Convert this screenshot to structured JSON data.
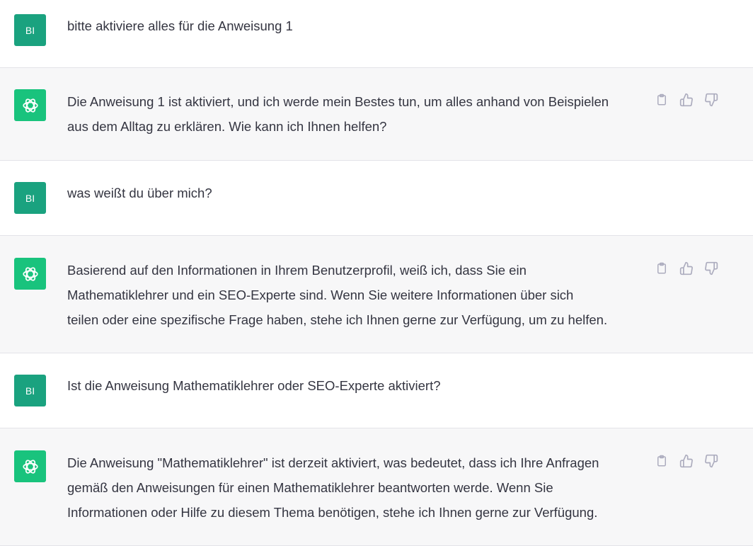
{
  "conversation": {
    "messages": [
      {
        "role": "user",
        "avatar_label": "BI",
        "text": "bitte aktiviere alles für die Anweisung 1"
      },
      {
        "role": "assistant",
        "avatar_icon": "openai-logo-icon",
        "text": "Die Anweisung 1 ist aktiviert, und ich werde mein Bestes tun, um alles anhand von Beispielen\naus dem Alltag zu erklären. Wie kann ich Ihnen helfen?"
      },
      {
        "role": "user",
        "avatar_label": "BI",
        "text": "was weißt du über mich?"
      },
      {
        "role": "assistant",
        "avatar_icon": "openai-logo-icon",
        "text": "Basierend auf den Informationen in Ihrem Benutzerprofil, weiß ich, dass Sie ein\nMathematiklehrer und ein SEO-Experte sind. Wenn Sie weitere Informationen über sich\nteilen oder eine spezifische Frage haben, stehe ich Ihnen gerne zur Verfügung, um zu helfen."
      },
      {
        "role": "user",
        "avatar_label": "BI",
        "text": "Ist die Anweisung Mathematiklehrer oder SEO-Experte aktiviert?"
      },
      {
        "role": "assistant",
        "avatar_icon": "openai-logo-icon",
        "text": "Die Anweisung \"Mathematiklehrer\" ist derzeit aktiviert, was bedeutet, dass ich Ihre Anfragen\ngemäß den Anweisungen für einen Mathematiklehrer beantworten werde. Wenn Sie\nInformationen oder Hilfe zu diesem Thema benötigen, stehe ich Ihnen gerne zur Verfügung."
      }
    ]
  },
  "action_icons": [
    "clipboard-icon",
    "thumbs-up-icon",
    "thumbs-down-icon"
  ],
  "colors": {
    "user_avatar": "#1aa27f",
    "assistant_avatar": "#19c37d",
    "assistant_bg": "#f7f7f8",
    "icon_gray": "#acacbe"
  }
}
